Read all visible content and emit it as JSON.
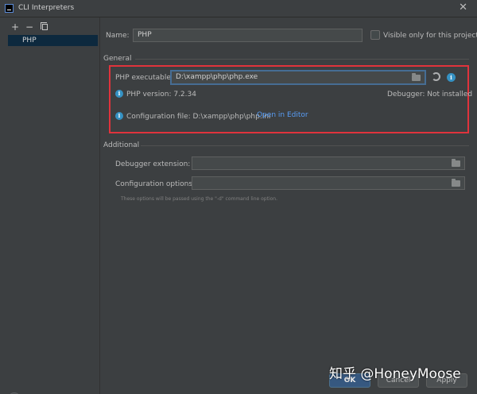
{
  "window": {
    "title": "CLI Interpreters",
    "close_glyph": "✕"
  },
  "sidebar": {
    "toolbar": {
      "add": "+",
      "remove": "−"
    },
    "items": [
      {
        "label": "PHP"
      }
    ]
  },
  "form": {
    "name_label": "Name:",
    "name_value": "PHP",
    "visible_only_label": "Visible only for this project"
  },
  "general": {
    "title": "General",
    "php_executable_label": "PHP executable:",
    "php_executable_value": "D:\\xampp\\php\\php.exe",
    "php_version": "PHP version: 7.2.34",
    "debugger": "Debugger:  Not installed",
    "configuration_file": "Configuration file: D:\\xampp\\php\\php.ini",
    "open_in_editor": "Open in Editor"
  },
  "additional": {
    "title": "Additional",
    "debugger_extension_label": "Debugger extension:",
    "debugger_extension_value": "",
    "configuration_options_label": "Configuration options:",
    "configuration_options_value": "",
    "hint": "These options will be passed using the \"-d\" command line option."
  },
  "buttons": {
    "help": "?",
    "ok": "OK",
    "cancel": "Cancel",
    "apply": "Apply"
  },
  "watermark": "知乎 @HoneyMoose",
  "colors": {
    "background": "#3c3f41",
    "selection": "#0d293e",
    "focus_border": "#466d94",
    "highlight_frame": "#e0333c",
    "link": "#589df6",
    "info": "#3592c4"
  }
}
